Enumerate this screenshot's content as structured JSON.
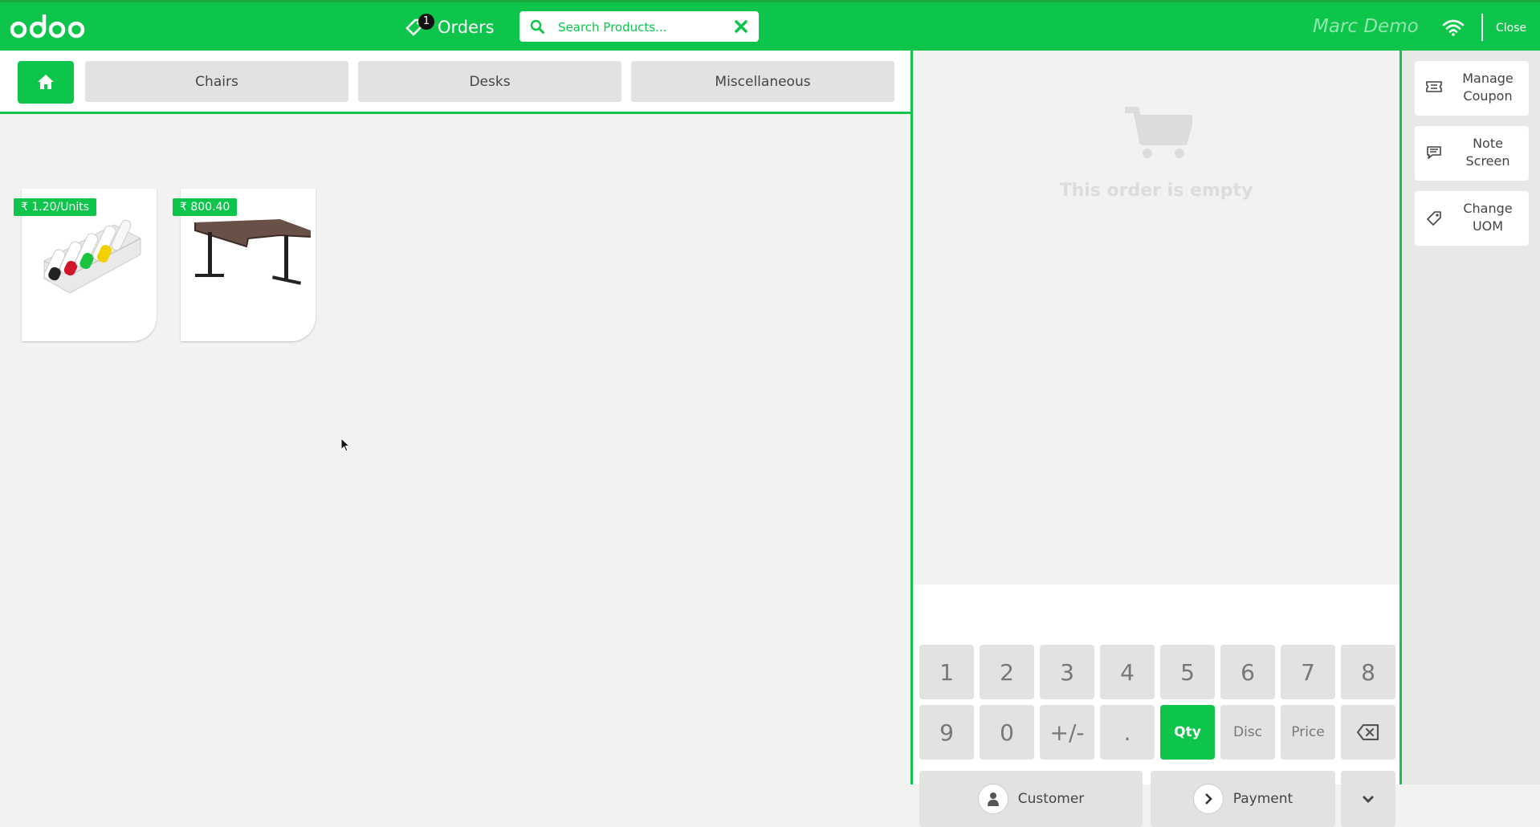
{
  "header": {
    "orders_label": "Orders",
    "orders_count": "1",
    "search_placeholder": "Search Products...",
    "user_name": "Marc Demo",
    "close_label": "Close"
  },
  "categories": [
    "Chairs",
    "Desks",
    "Miscellaneous"
  ],
  "products": [
    {
      "price": "₹ 1.20/Units",
      "image": "whiteboard-markers-image"
    },
    {
      "price": "₹ 800.40",
      "image": "desk-image"
    }
  ],
  "order": {
    "empty_text": "This order is empty"
  },
  "numpad": {
    "row1": [
      "1",
      "2",
      "3",
      "4",
      "5",
      "6",
      "7",
      "8"
    ],
    "row2": [
      "9",
      "0",
      "+/-",
      "."
    ],
    "modes": [
      "Qty",
      "Disc",
      "Price"
    ],
    "active_mode": "Qty",
    "customer_label": "Customer",
    "payment_label": "Payment"
  },
  "controls": [
    {
      "line1": "Manage",
      "line2": "Coupon",
      "icon": "ticket-icon"
    },
    {
      "line1": "Note",
      "line2": "Screen",
      "icon": "note-icon"
    },
    {
      "line1": "Change",
      "line2": "UOM",
      "icon": "tag-icon"
    }
  ],
  "colors": {
    "brand_green": "#0cc54a",
    "key_bg": "#e2e2e0",
    "pane_bg": "#f2f2f1"
  }
}
